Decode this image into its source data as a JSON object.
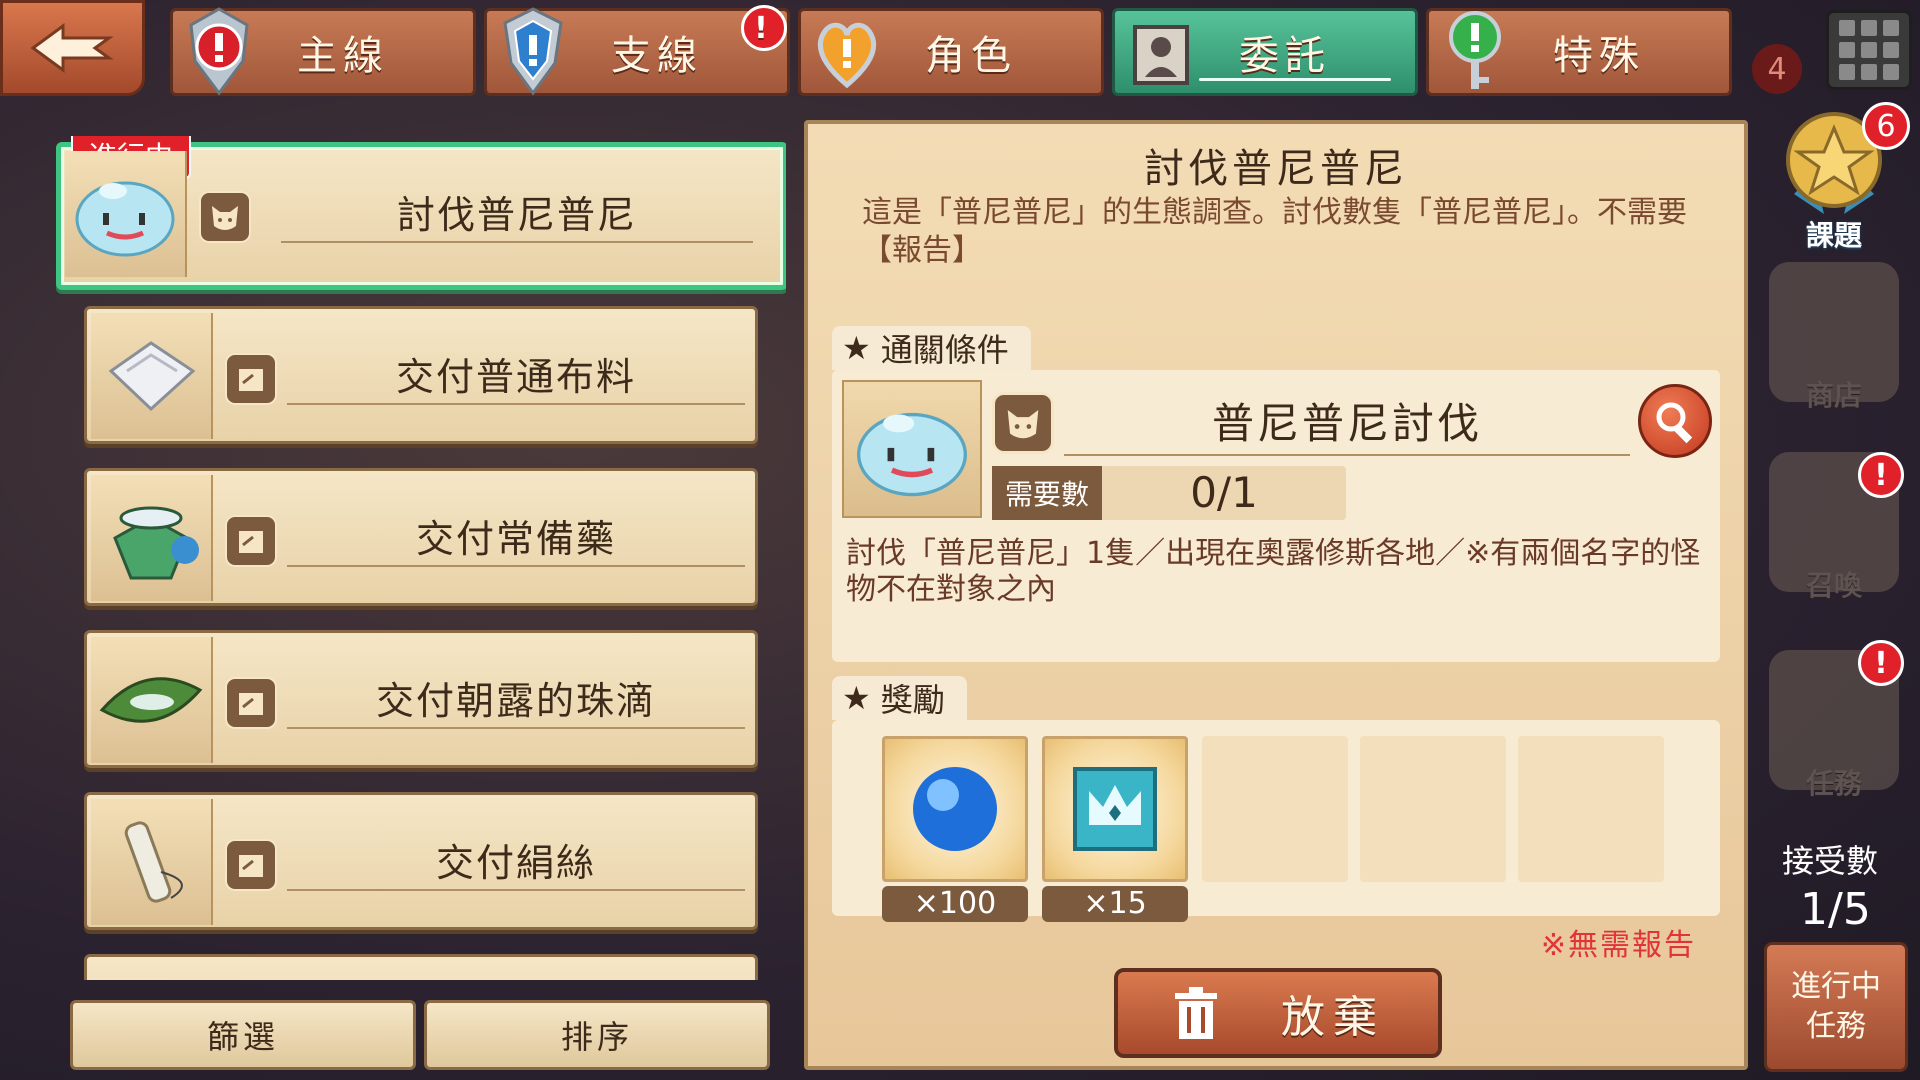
{
  "tabs": [
    {
      "label": "主線",
      "icon": "exclamation-shield-icon",
      "alert": false
    },
    {
      "label": "支線",
      "icon": "blue-shield-icon",
      "alert": true
    },
    {
      "label": "角色",
      "icon": "heart-icon",
      "alert": false
    },
    {
      "label": "委託",
      "icon": "portrait-icon",
      "alert": false,
      "active": true
    },
    {
      "label": "特殊",
      "icon": "green-key-icon",
      "alert": false
    }
  ],
  "top_badge": "4",
  "quests": [
    {
      "title": "討伐普尼普尼",
      "status": "進行中",
      "thumb": "slime-icon",
      "type_icon": "monster-icon"
    },
    {
      "title": "交付普通布料",
      "thumb": "cloth-icon",
      "type_icon": "delivery-icon"
    },
    {
      "title": "交付常備藥",
      "thumb": "medicine-jar-icon",
      "type_icon": "delivery-icon"
    },
    {
      "title": "交付朝露的珠滴",
      "thumb": "leaf-dew-icon",
      "type_icon": "delivery-icon"
    },
    {
      "title": "交付絹絲",
      "thumb": "silk-spool-icon",
      "type_icon": "delivery-icon"
    }
  ],
  "filter_label": "篩選",
  "sort_label": "排序",
  "detail": {
    "title": "討伐普尼普尼",
    "description": "這是「普尼普尼」的生態調查。討伐數隻「普尼普尼」。不需要【報告】",
    "clear_label": "通關條件",
    "condition": {
      "name": "普尼普尼討伐",
      "need_label": "需要數",
      "need_value": "0/1",
      "description": "討伐「普尼普尼」1隻／出現在奧露修斯各地／※有兩個名字的怪物不在對象之內"
    },
    "reward_label": "獎勵",
    "rewards": [
      {
        "icon": "blue-orb-icon",
        "qty": "×100"
      },
      {
        "icon": "crown-ticket-icon",
        "qty": "×15"
      }
    ],
    "no_report": "※無需報告",
    "abandon_label": "放棄"
  },
  "sidebar": {
    "medal_badge": "6",
    "medal_label": "課題",
    "shop_label": "商店",
    "summon_label": "召喚",
    "mission_label": "任務",
    "accept_label": "接受數",
    "accept_count": "1/5",
    "ongoing_label_1": "進行中",
    "ongoing_label_2": "任務"
  },
  "colors": {
    "active_tab": "#3aa57e",
    "tab": "#b46644",
    "panel": "#f0d6ac",
    "alert": "#e0212a"
  }
}
